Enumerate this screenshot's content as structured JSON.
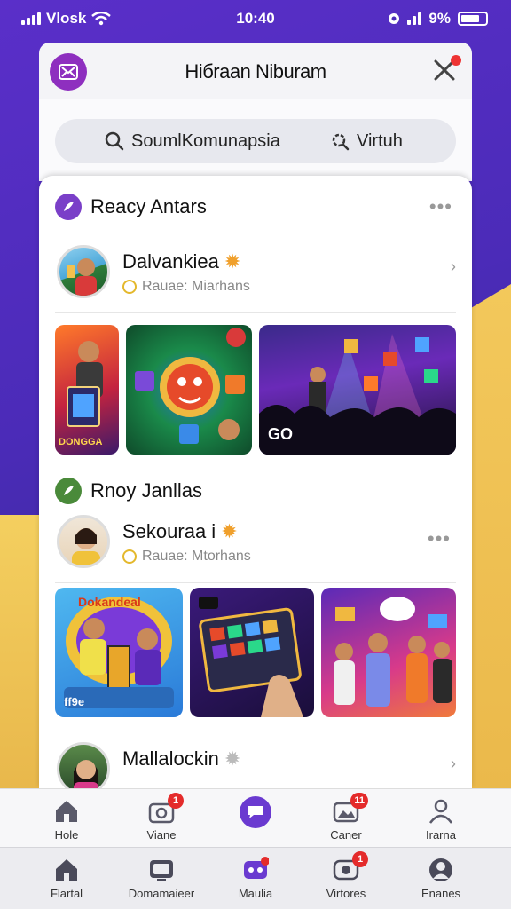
{
  "status_bar": {
    "carrier": "Vlosk",
    "time": "10:40",
    "battery": "9%"
  },
  "header": {
    "title": "Hiбraan Niburam"
  },
  "search": {
    "left_label": "SoumlKomunapsia",
    "right_label": "Virtuh"
  },
  "sections": [
    {
      "title": "Reacy Antars",
      "user": {
        "name": "Dalvankiea",
        "subtitle": "Rauae: Miarhans"
      },
      "tile_caption": "GO",
      "tile_label_1": "DONGGA"
    },
    {
      "title": "Rnoy Janllas",
      "user": {
        "name": "Sekouraa i",
        "subtitle": "Rauae: Mtorhans"
      },
      "tile_label_1": "Dokandeal",
      "tile_label_2": "ff9e"
    },
    {
      "title": "",
      "user": {
        "name": "Mallalockin",
        "subtitle": ""
      }
    }
  ],
  "nav_top": [
    {
      "label": "Hole",
      "icon": "home-icon",
      "badge": ""
    },
    {
      "label": "Viane",
      "icon": "camera-icon",
      "badge": "1"
    },
    {
      "label": "",
      "icon": "chat-icon",
      "badge": ""
    },
    {
      "label": "Caner",
      "icon": "gallery-icon",
      "badge": "11"
    },
    {
      "label": "Irarna",
      "icon": "profile-icon",
      "badge": ""
    }
  ],
  "nav_bottom": [
    {
      "label": "Flartal",
      "icon": "home-icon",
      "badge": ""
    },
    {
      "label": "Domamaieer",
      "icon": "tv-icon",
      "badge": ""
    },
    {
      "label": "Maulia",
      "icon": "game-icon",
      "badge": ""
    },
    {
      "label": "Virtores",
      "icon": "stream-icon",
      "badge": "1"
    },
    {
      "label": "Enanes",
      "icon": "user-icon",
      "badge": ""
    }
  ],
  "colors": {
    "accent": "#6a3ad0",
    "badge": "#e42b2b",
    "background": "#4b2bb8"
  }
}
